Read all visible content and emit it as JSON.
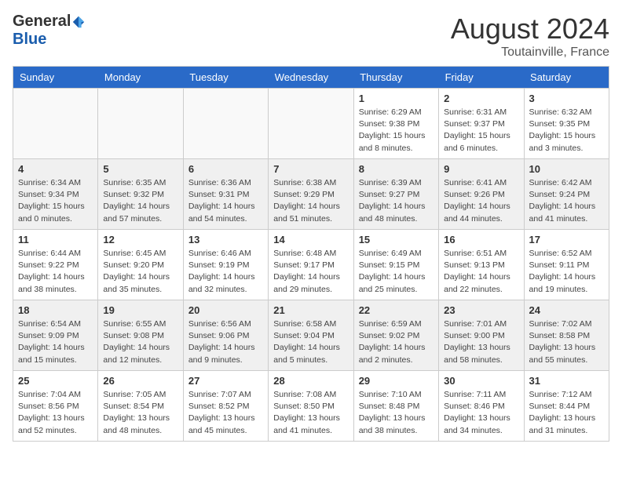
{
  "header": {
    "logo_general": "General",
    "logo_blue": "Blue",
    "month_year": "August 2024",
    "location": "Toutainville, France"
  },
  "calendar": {
    "days_of_week": [
      "Sunday",
      "Monday",
      "Tuesday",
      "Wednesday",
      "Thursday",
      "Friday",
      "Saturday"
    ],
    "weeks": [
      [
        {
          "day": "",
          "info": ""
        },
        {
          "day": "",
          "info": ""
        },
        {
          "day": "",
          "info": ""
        },
        {
          "day": "",
          "info": ""
        },
        {
          "day": "1",
          "info": "Sunrise: 6:29 AM\nSunset: 9:38 PM\nDaylight: 15 hours\nand 8 minutes."
        },
        {
          "day": "2",
          "info": "Sunrise: 6:31 AM\nSunset: 9:37 PM\nDaylight: 15 hours\nand 6 minutes."
        },
        {
          "day": "3",
          "info": "Sunrise: 6:32 AM\nSunset: 9:35 PM\nDaylight: 15 hours\nand 3 minutes."
        }
      ],
      [
        {
          "day": "4",
          "info": "Sunrise: 6:34 AM\nSunset: 9:34 PM\nDaylight: 15 hours\nand 0 minutes."
        },
        {
          "day": "5",
          "info": "Sunrise: 6:35 AM\nSunset: 9:32 PM\nDaylight: 14 hours\nand 57 minutes."
        },
        {
          "day": "6",
          "info": "Sunrise: 6:36 AM\nSunset: 9:31 PM\nDaylight: 14 hours\nand 54 minutes."
        },
        {
          "day": "7",
          "info": "Sunrise: 6:38 AM\nSunset: 9:29 PM\nDaylight: 14 hours\nand 51 minutes."
        },
        {
          "day": "8",
          "info": "Sunrise: 6:39 AM\nSunset: 9:27 PM\nDaylight: 14 hours\nand 48 minutes."
        },
        {
          "day": "9",
          "info": "Sunrise: 6:41 AM\nSunset: 9:26 PM\nDaylight: 14 hours\nand 44 minutes."
        },
        {
          "day": "10",
          "info": "Sunrise: 6:42 AM\nSunset: 9:24 PM\nDaylight: 14 hours\nand 41 minutes."
        }
      ],
      [
        {
          "day": "11",
          "info": "Sunrise: 6:44 AM\nSunset: 9:22 PM\nDaylight: 14 hours\nand 38 minutes."
        },
        {
          "day": "12",
          "info": "Sunrise: 6:45 AM\nSunset: 9:20 PM\nDaylight: 14 hours\nand 35 minutes."
        },
        {
          "day": "13",
          "info": "Sunrise: 6:46 AM\nSunset: 9:19 PM\nDaylight: 14 hours\nand 32 minutes."
        },
        {
          "day": "14",
          "info": "Sunrise: 6:48 AM\nSunset: 9:17 PM\nDaylight: 14 hours\nand 29 minutes."
        },
        {
          "day": "15",
          "info": "Sunrise: 6:49 AM\nSunset: 9:15 PM\nDaylight: 14 hours\nand 25 minutes."
        },
        {
          "day": "16",
          "info": "Sunrise: 6:51 AM\nSunset: 9:13 PM\nDaylight: 14 hours\nand 22 minutes."
        },
        {
          "day": "17",
          "info": "Sunrise: 6:52 AM\nSunset: 9:11 PM\nDaylight: 14 hours\nand 19 minutes."
        }
      ],
      [
        {
          "day": "18",
          "info": "Sunrise: 6:54 AM\nSunset: 9:09 PM\nDaylight: 14 hours\nand 15 minutes."
        },
        {
          "day": "19",
          "info": "Sunrise: 6:55 AM\nSunset: 9:08 PM\nDaylight: 14 hours\nand 12 minutes."
        },
        {
          "day": "20",
          "info": "Sunrise: 6:56 AM\nSunset: 9:06 PM\nDaylight: 14 hours\nand 9 minutes."
        },
        {
          "day": "21",
          "info": "Sunrise: 6:58 AM\nSunset: 9:04 PM\nDaylight: 14 hours\nand 5 minutes."
        },
        {
          "day": "22",
          "info": "Sunrise: 6:59 AM\nSunset: 9:02 PM\nDaylight: 14 hours\nand 2 minutes."
        },
        {
          "day": "23",
          "info": "Sunrise: 7:01 AM\nSunset: 9:00 PM\nDaylight: 13 hours\nand 58 minutes."
        },
        {
          "day": "24",
          "info": "Sunrise: 7:02 AM\nSunset: 8:58 PM\nDaylight: 13 hours\nand 55 minutes."
        }
      ],
      [
        {
          "day": "25",
          "info": "Sunrise: 7:04 AM\nSunset: 8:56 PM\nDaylight: 13 hours\nand 52 minutes."
        },
        {
          "day": "26",
          "info": "Sunrise: 7:05 AM\nSunset: 8:54 PM\nDaylight: 13 hours\nand 48 minutes."
        },
        {
          "day": "27",
          "info": "Sunrise: 7:07 AM\nSunset: 8:52 PM\nDaylight: 13 hours\nand 45 minutes."
        },
        {
          "day": "28",
          "info": "Sunrise: 7:08 AM\nSunset: 8:50 PM\nDaylight: 13 hours\nand 41 minutes."
        },
        {
          "day": "29",
          "info": "Sunrise: 7:10 AM\nSunset: 8:48 PM\nDaylight: 13 hours\nand 38 minutes."
        },
        {
          "day": "30",
          "info": "Sunrise: 7:11 AM\nSunset: 8:46 PM\nDaylight: 13 hours\nand 34 minutes."
        },
        {
          "day": "31",
          "info": "Sunrise: 7:12 AM\nSunset: 8:44 PM\nDaylight: 13 hours\nand 31 minutes."
        }
      ]
    ]
  }
}
